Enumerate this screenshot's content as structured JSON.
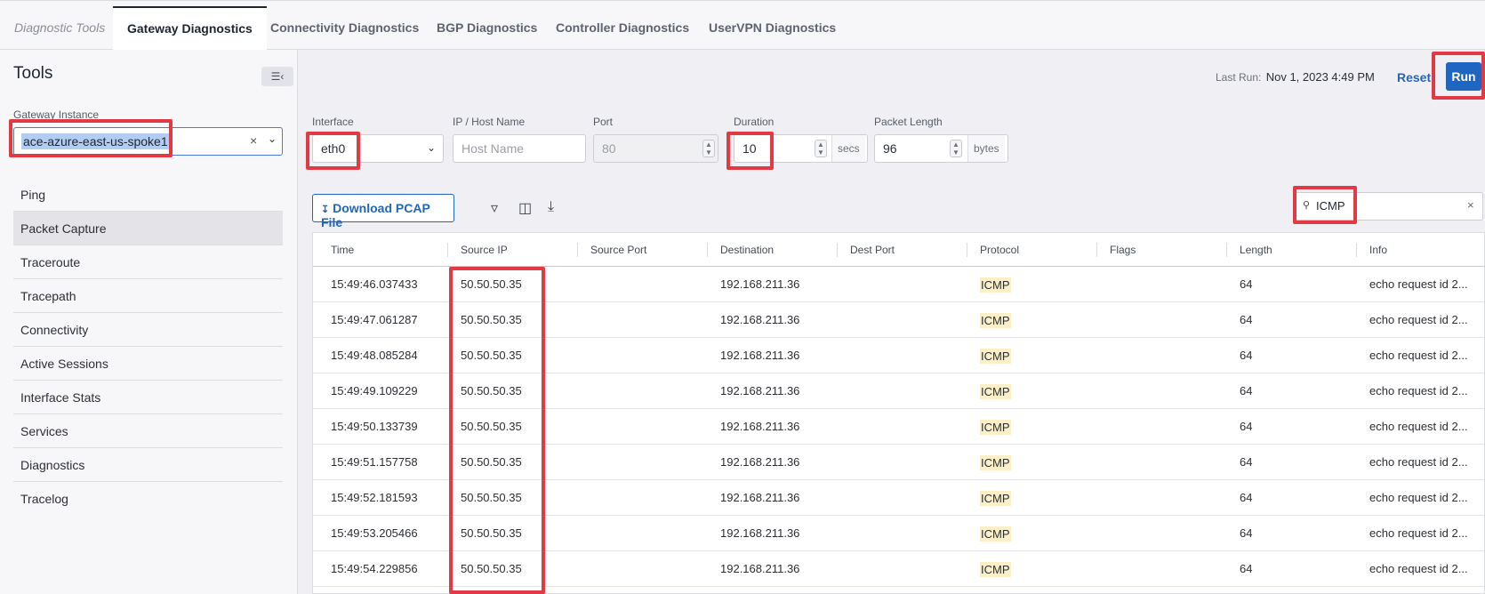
{
  "breadcrumb": "Diagnostic Tools",
  "tabs": [
    {
      "label": "Gateway Diagnostics",
      "active": true
    },
    {
      "label": "Connectivity Diagnostics"
    },
    {
      "label": "BGP Diagnostics"
    },
    {
      "label": "Controller Diagnostics"
    },
    {
      "label": "UserVPN Diagnostics"
    }
  ],
  "sidebar": {
    "title": "Tools",
    "gateway_label": "Gateway Instance",
    "gateway_value": "ace-azure-east-us-spoke1",
    "items": [
      {
        "label": "Ping"
      },
      {
        "label": "Packet Capture",
        "selected": true
      },
      {
        "label": "Traceroute"
      },
      {
        "label": "Tracepath"
      },
      {
        "label": "Connectivity"
      },
      {
        "label": "Active Sessions"
      },
      {
        "label": "Interface Stats"
      },
      {
        "label": "Services"
      },
      {
        "label": "Diagnostics"
      },
      {
        "label": "Tracelog"
      }
    ]
  },
  "header": {
    "last_run_label": "Last Run:",
    "last_run_value": "Nov 1, 2023 4:49 PM",
    "reset_label": "Reset",
    "run_label": "Run"
  },
  "form": {
    "interface_label": "Interface",
    "interface_value": "eth0",
    "host_label": "IP / Host Name",
    "host_placeholder": "Host Name",
    "port_label": "Port",
    "port_value": "80",
    "duration_label": "Duration",
    "duration_value": "10",
    "duration_unit": "secs",
    "packet_length_label": "Packet Length",
    "packet_length_value": "96",
    "packet_length_unit": "bytes"
  },
  "toolbar": {
    "download_label": "Download PCAP File",
    "search_value": "ICMP"
  },
  "table": {
    "columns": [
      "Time",
      "Source IP",
      "Source Port",
      "Destination",
      "Dest Port",
      "Protocol",
      "Flags",
      "Length",
      "Info"
    ],
    "rows": [
      [
        "15:49:46.037433",
        "50.50.50.35",
        "",
        "192.168.211.36",
        "",
        "ICMP",
        "",
        "64",
        "echo request id 2..."
      ],
      [
        "15:49:47.061287",
        "50.50.50.35",
        "",
        "192.168.211.36",
        "",
        "ICMP",
        "",
        "64",
        "echo request id 2..."
      ],
      [
        "15:49:48.085284",
        "50.50.50.35",
        "",
        "192.168.211.36",
        "",
        "ICMP",
        "",
        "64",
        "echo request id 2..."
      ],
      [
        "15:49:49.109229",
        "50.50.50.35",
        "",
        "192.168.211.36",
        "",
        "ICMP",
        "",
        "64",
        "echo request id 2..."
      ],
      [
        "15:49:50.133739",
        "50.50.50.35",
        "",
        "192.168.211.36",
        "",
        "ICMP",
        "",
        "64",
        "echo request id 2..."
      ],
      [
        "15:49:51.157758",
        "50.50.50.35",
        "",
        "192.168.211.36",
        "",
        "ICMP",
        "",
        "64",
        "echo request id 2..."
      ],
      [
        "15:49:52.181593",
        "50.50.50.35",
        "",
        "192.168.211.36",
        "",
        "ICMP",
        "",
        "64",
        "echo request id 2..."
      ],
      [
        "15:49:53.205466",
        "50.50.50.35",
        "",
        "192.168.211.36",
        "",
        "ICMP",
        "",
        "64",
        "echo request id 2..."
      ],
      [
        "15:49:54.229856",
        "50.50.50.35",
        "",
        "192.168.211.36",
        "",
        "ICMP",
        "",
        "64",
        "echo request id 2..."
      ]
    ]
  },
  "colors": {
    "accent": "#1f66c2",
    "highlight": "#e23a44",
    "protocol_badge": "#fbefc8"
  }
}
